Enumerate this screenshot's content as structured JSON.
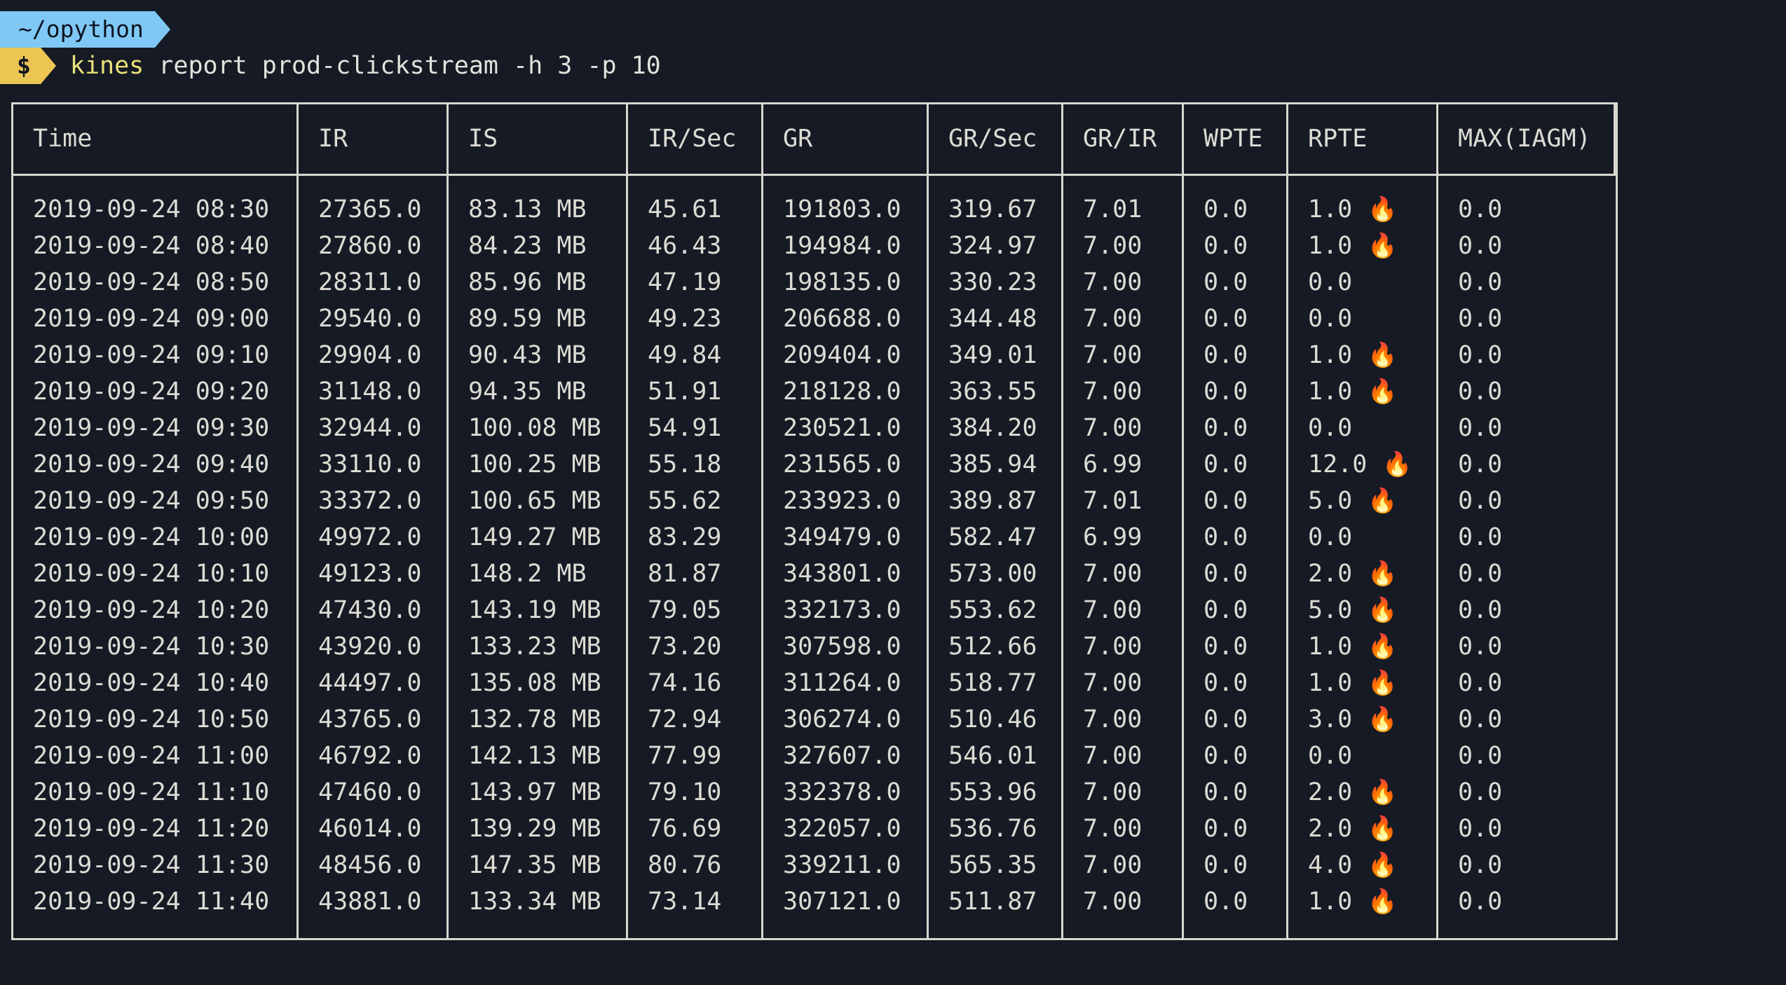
{
  "prompt": {
    "path": "~/opython",
    "symbol": "$",
    "command_name": "kines",
    "command_args": " report prod-clickstream -h 3 -p 10"
  },
  "table": {
    "headers": [
      "Time",
      "IR",
      "IS",
      "IR/Sec",
      "GR",
      "GR/Sec",
      "GR/IR",
      "WPTE",
      "RPTE",
      "MAX(IAGM)"
    ],
    "rows": [
      [
        "2019-09-24 08:30",
        "27365.0",
        "83.13 MB",
        "45.61",
        "191803.0",
        "319.67",
        "7.01",
        "0.0",
        "1.0",
        "0.0"
      ],
      [
        "2019-09-24 08:40",
        "27860.0",
        "84.23 MB",
        "46.43",
        "194984.0",
        "324.97",
        "7.00",
        "0.0",
        "1.0",
        "0.0"
      ],
      [
        "2019-09-24 08:50",
        "28311.0",
        "85.96 MB",
        "47.19",
        "198135.0",
        "330.23",
        "7.00",
        "0.0",
        "0.0",
        "0.0"
      ],
      [
        "2019-09-24 09:00",
        "29540.0",
        "89.59 MB",
        "49.23",
        "206688.0",
        "344.48",
        "7.00",
        "0.0",
        "0.0",
        "0.0"
      ],
      [
        "2019-09-24 09:10",
        "29904.0",
        "90.43 MB",
        "49.84",
        "209404.0",
        "349.01",
        "7.00",
        "0.0",
        "1.0",
        "0.0"
      ],
      [
        "2019-09-24 09:20",
        "31148.0",
        "94.35 MB",
        "51.91",
        "218128.0",
        "363.55",
        "7.00",
        "0.0",
        "1.0",
        "0.0"
      ],
      [
        "2019-09-24 09:30",
        "32944.0",
        "100.08 MB",
        "54.91",
        "230521.0",
        "384.20",
        "7.00",
        "0.0",
        "0.0",
        "0.0"
      ],
      [
        "2019-09-24 09:40",
        "33110.0",
        "100.25 MB",
        "55.18",
        "231565.0",
        "385.94",
        "6.99",
        "0.0",
        "12.0",
        "0.0"
      ],
      [
        "2019-09-24 09:50",
        "33372.0",
        "100.65 MB",
        "55.62",
        "233923.0",
        "389.87",
        "7.01",
        "0.0",
        "5.0",
        "0.0"
      ],
      [
        "2019-09-24 10:00",
        "49972.0",
        "149.27 MB",
        "83.29",
        "349479.0",
        "582.47",
        "6.99",
        "0.0",
        "0.0",
        "0.0"
      ],
      [
        "2019-09-24 10:10",
        "49123.0",
        "148.2 MB",
        "81.87",
        "343801.0",
        "573.00",
        "7.00",
        "0.0",
        "2.0",
        "0.0"
      ],
      [
        "2019-09-24 10:20",
        "47430.0",
        "143.19 MB",
        "79.05",
        "332173.0",
        "553.62",
        "7.00",
        "0.0",
        "5.0",
        "0.0"
      ],
      [
        "2019-09-24 10:30",
        "43920.0",
        "133.23 MB",
        "73.20",
        "307598.0",
        "512.66",
        "7.00",
        "0.0",
        "1.0",
        "0.0"
      ],
      [
        "2019-09-24 10:40",
        "44497.0",
        "135.08 MB",
        "74.16",
        "311264.0",
        "518.77",
        "7.00",
        "0.0",
        "1.0",
        "0.0"
      ],
      [
        "2019-09-24 10:50",
        "43765.0",
        "132.78 MB",
        "72.94",
        "306274.0",
        "510.46",
        "7.00",
        "0.0",
        "3.0",
        "0.0"
      ],
      [
        "2019-09-24 11:00",
        "46792.0",
        "142.13 MB",
        "77.99",
        "327607.0",
        "546.01",
        "7.00",
        "0.0",
        "0.0",
        "0.0"
      ],
      [
        "2019-09-24 11:10",
        "47460.0",
        "143.97 MB",
        "79.10",
        "332378.0",
        "553.96",
        "7.00",
        "0.0",
        "2.0",
        "0.0"
      ],
      [
        "2019-09-24 11:20",
        "46014.0",
        "139.29 MB",
        "76.69",
        "322057.0",
        "536.76",
        "7.00",
        "0.0",
        "2.0",
        "0.0"
      ],
      [
        "2019-09-24 11:30",
        "48456.0",
        "147.35 MB",
        "80.76",
        "339211.0",
        "565.35",
        "7.00",
        "0.0",
        "4.0",
        "0.0"
      ],
      [
        "2019-09-24 11:40",
        "43881.0",
        "133.34 MB",
        "73.14",
        "307121.0",
        "511.87",
        "7.00",
        "0.0",
        "1.0",
        "0.0"
      ]
    ],
    "fire_icon": "fire-icon"
  }
}
